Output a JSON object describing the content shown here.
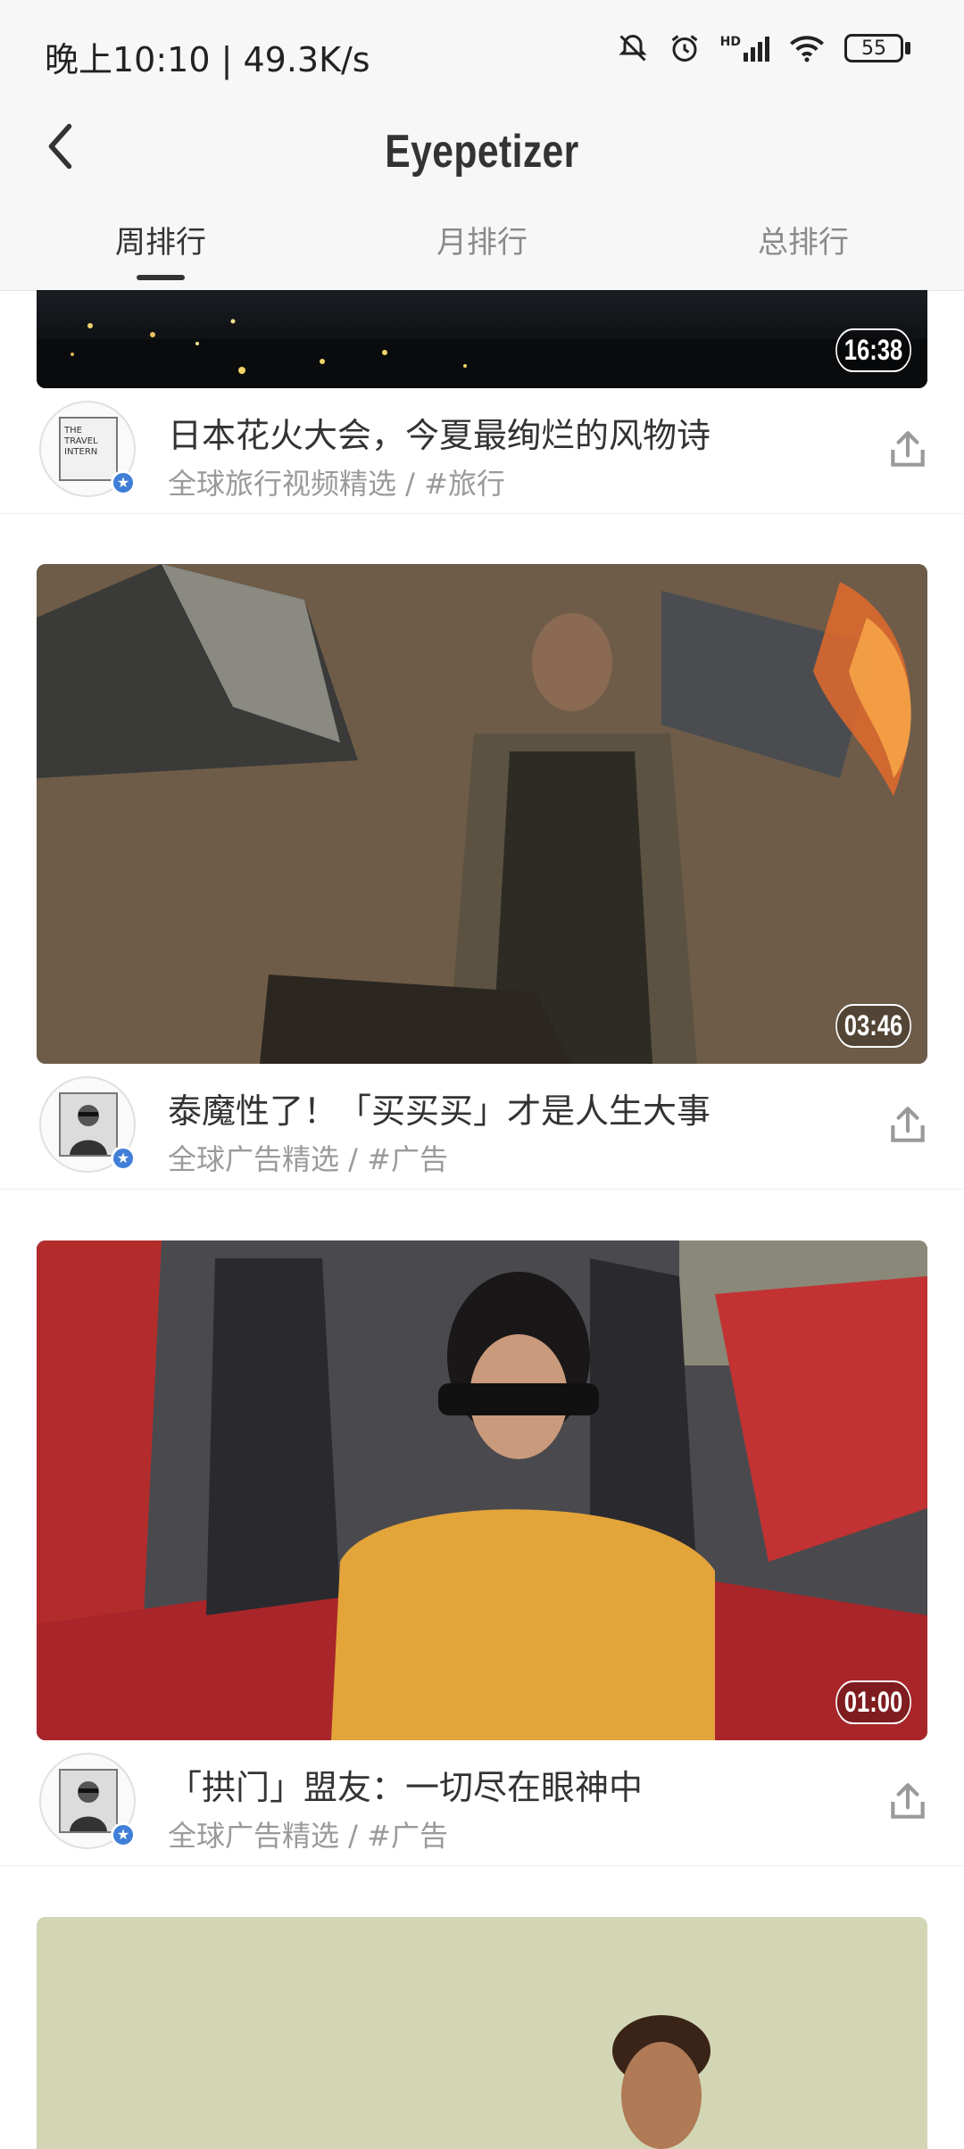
{
  "status_bar": {
    "time_speed": "晚上10:10 | 49.3K/s",
    "battery": "55",
    "network_label": "HD"
  },
  "header": {
    "title": "Eyepetizer",
    "tabs": [
      {
        "label": "周排行",
        "active": true
      },
      {
        "label": "月排行",
        "active": false
      },
      {
        "label": "总排行",
        "active": false
      }
    ]
  },
  "videos": [
    {
      "duration": "16:38",
      "title": "日本花火大会，今夏最绚烂的风物诗",
      "meta": "全球旅行视频精选  /  #旅行",
      "avatar_text": "THE TRAVEL INTERN",
      "thumb_icon": "night-fireworks-thumbnail"
    },
    {
      "duration": "03:46",
      "title": "泰魔性了！「买买买」才是人生大事",
      "meta": "全球广告精选  /  #广告",
      "avatar_text": "",
      "thumb_icon": "camping-fire-thumbnail"
    },
    {
      "duration": "01:00",
      "title": "「拱门」盟友：一切尽在眼神中",
      "meta": "全球广告精选  /  #广告",
      "avatar_text": "",
      "thumb_icon": "red-car-thumbnail"
    },
    {
      "duration": "",
      "title": "",
      "meta": "",
      "avatar_text": "",
      "thumb_icon": "man-outdoor-thumbnail"
    }
  ],
  "colors": {
    "header_bg": "#f7f7f7",
    "text_primary": "#333333",
    "text_secondary": "#9a9a9a",
    "badge_blue": "#3f7fd8"
  }
}
